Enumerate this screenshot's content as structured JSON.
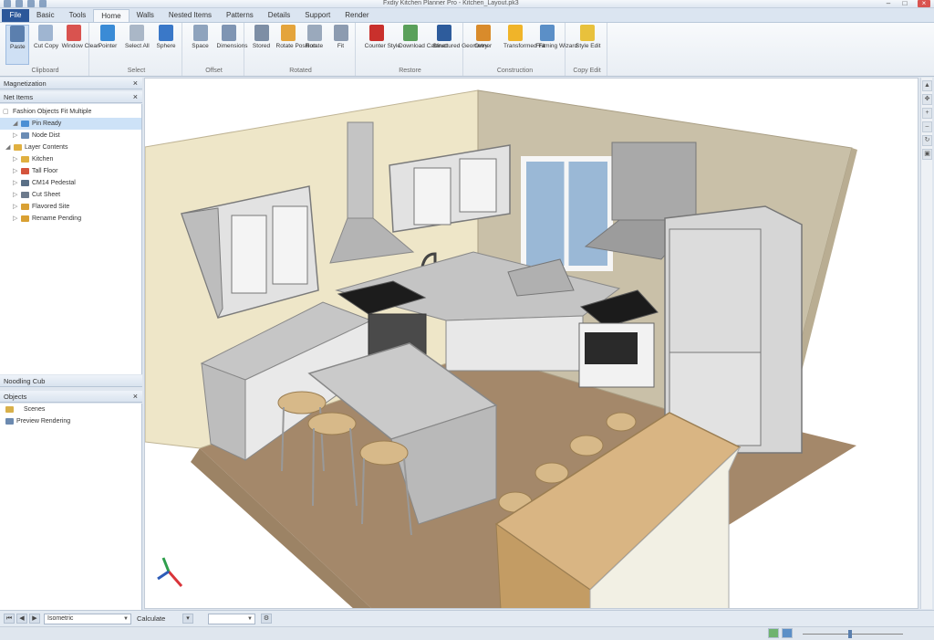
{
  "window": {
    "title": "Fxdiy Kitchen Planner Pro - Kitchen_Layout.pk3",
    "qat": [
      "save",
      "undo",
      "redo",
      "print"
    ]
  },
  "ribbon": {
    "tabs": [
      {
        "label": "File",
        "kind": "file"
      },
      {
        "label": "Basic",
        "kind": ""
      },
      {
        "label": "Tools",
        "kind": ""
      },
      {
        "label": "Home",
        "kind": "active"
      },
      {
        "label": "Walls",
        "kind": ""
      },
      {
        "label": "Nested Items",
        "kind": ""
      },
      {
        "label": "Patterns",
        "kind": ""
      },
      {
        "label": "Details",
        "kind": ""
      },
      {
        "label": "Support",
        "kind": ""
      },
      {
        "label": "Render",
        "kind": ""
      }
    ],
    "groups": [
      {
        "label": "Clipboard",
        "buttons": [
          {
            "label": "Paste",
            "icon": "paste-icon",
            "color": "#5b7fae",
            "active": true
          },
          {
            "label": "Cut Copy",
            "icon": "copy-icon",
            "color": "#9fb5d1"
          },
          {
            "label": "Window Clean",
            "icon": "clean-icon",
            "color": "#d9534f"
          }
        ]
      },
      {
        "label": "Select",
        "buttons": [
          {
            "label": "Pointer",
            "icon": "pointer-icon",
            "color": "#3a8bd6"
          },
          {
            "label": "Select All",
            "icon": "select-icon",
            "color": "#aab7c7"
          },
          {
            "label": "Sphere",
            "icon": "sphere-icon",
            "color": "#3a78c8"
          }
        ]
      },
      {
        "label": "Offset",
        "buttons": [
          {
            "label": "Space",
            "icon": "space-icon",
            "color": "#8ea3bd"
          },
          {
            "label": "Dimensions",
            "icon": "dimensions-icon",
            "color": "#7f95b3"
          }
        ]
      },
      {
        "label": "Rotated",
        "buttons": [
          {
            "label": "Stored",
            "icon": "stored-icon",
            "color": "#7d8ea5"
          },
          {
            "label": "Rotate Position",
            "icon": "rotate-icon",
            "color": "#e4a43b"
          },
          {
            "label": "Rotate",
            "icon": "spin-icon",
            "color": "#9aa9bc"
          },
          {
            "label": "Fit",
            "icon": "fit-icon",
            "color": "#8c9bb0"
          }
        ]
      },
      {
        "label": "Restore",
        "buttons": [
          {
            "label": "Counter Style",
            "icon": "counter-icon",
            "color": "#c9302c"
          },
          {
            "label": "Download Cabinet",
            "icon": "download-icon",
            "color": "#5aa05a"
          },
          {
            "label": "Structured Geometry",
            "icon": "geometry-icon",
            "color": "#2e5c9c"
          }
        ]
      },
      {
        "label": "Construction",
        "buttons": [
          {
            "label": "Owner",
            "icon": "owner-icon",
            "color": "#d98b2b"
          },
          {
            "label": "Transformed Fit",
            "icon": "transform-icon",
            "color": "#f0b429"
          },
          {
            "label": "Framing Wizard",
            "icon": "wizard-icon",
            "color": "#5b8fc7"
          }
        ]
      },
      {
        "label": "Copy Edit",
        "buttons": [
          {
            "label": "Style Edit",
            "icon": "style-edit-icon",
            "color": "#e8c13c"
          }
        ]
      }
    ]
  },
  "panels": {
    "top": {
      "title": "Magnetization",
      "close": "×"
    },
    "tree": {
      "title": "Net Items",
      "close": "×",
      "root": "Fashion Objects Fit Multiple",
      "items": [
        {
          "label": "Pin Ready",
          "expanded": true,
          "color": "#4a8fd4",
          "selected": true,
          "level": 1
        },
        {
          "label": "Node Dist",
          "expanded": false,
          "color": "#6a8cb5",
          "selected": false,
          "level": 1
        },
        {
          "label": "Layer Contents",
          "expanded": true,
          "color": "#e0b040",
          "selected": false,
          "level": 0
        },
        {
          "label": "Kitchen",
          "expanded": false,
          "color": "#e0b040",
          "selected": false,
          "level": 1
        },
        {
          "label": "Tall Floor",
          "expanded": false,
          "color": "#d4543c",
          "selected": false,
          "level": 1
        },
        {
          "label": "CM14 Pedestal",
          "expanded": false,
          "color": "#5a6f86",
          "selected": false,
          "level": 1
        },
        {
          "label": "Cut Sheet",
          "expanded": false,
          "color": "#6c7a8c",
          "selected": false,
          "level": 1
        },
        {
          "label": "Flavored Site",
          "expanded": false,
          "color": "#d9a033",
          "selected": false,
          "level": 1
        },
        {
          "label": "Rename Pending",
          "expanded": false,
          "color": "#d9a033",
          "selected": false,
          "level": 1
        }
      ]
    },
    "mid": {
      "title": "Noodling Cub"
    },
    "objects": {
      "title": "Objects",
      "close": "×",
      "items": [
        {
          "label": "Scenes",
          "color": "#d8b04a"
        },
        {
          "label": "Preview Rendering",
          "color": "#6c8ab0"
        }
      ]
    }
  },
  "viewport": {
    "scene": "kitchen-3d-view",
    "axis": {
      "x": "#d9343a",
      "y": "#2e5cb8",
      "z": "#2e9e4c"
    }
  },
  "bottombar": {
    "view_select": "Isometric",
    "calc_label": "Calculate",
    "unit_select": ""
  },
  "statusbar": {
    "zoom_percent": 45
  }
}
